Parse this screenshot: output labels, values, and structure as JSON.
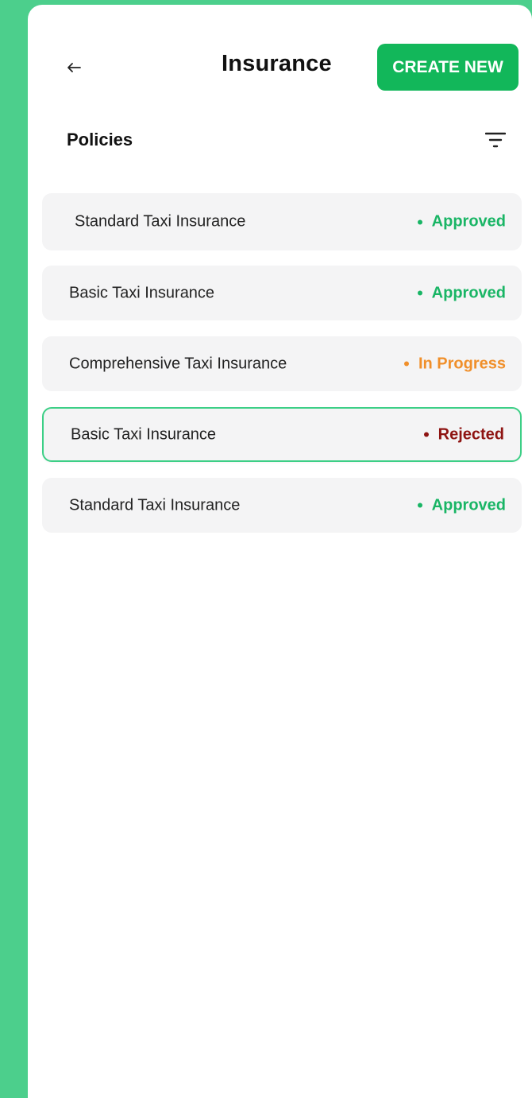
{
  "header": {
    "title": "Insurance",
    "create_label": "CREATE NEW",
    "back_icon": "arrow-left-icon"
  },
  "section": {
    "title": "Policies",
    "filter_icon": "filter-icon"
  },
  "colors": {
    "accent": "#12b75a",
    "approved": "#19b565",
    "in_progress": "#f08f2a",
    "rejected": "#8e1412",
    "background": "#4ccf8c"
  },
  "policies": [
    {
      "name": "Standard Taxi Insurance",
      "status": "Approved",
      "status_key": "approved"
    },
    {
      "name": "Basic Taxi Insurance",
      "status": "Approved",
      "status_key": "approved"
    },
    {
      "name": "Comprehensive Taxi Insurance",
      "status": "In Progress",
      "status_key": "in_progress"
    },
    {
      "name": "Basic Taxi Insurance",
      "status": "Rejected",
      "status_key": "rejected"
    },
    {
      "name": "Standard Taxi Insurance",
      "status": "Approved",
      "status_key": "approved"
    }
  ]
}
